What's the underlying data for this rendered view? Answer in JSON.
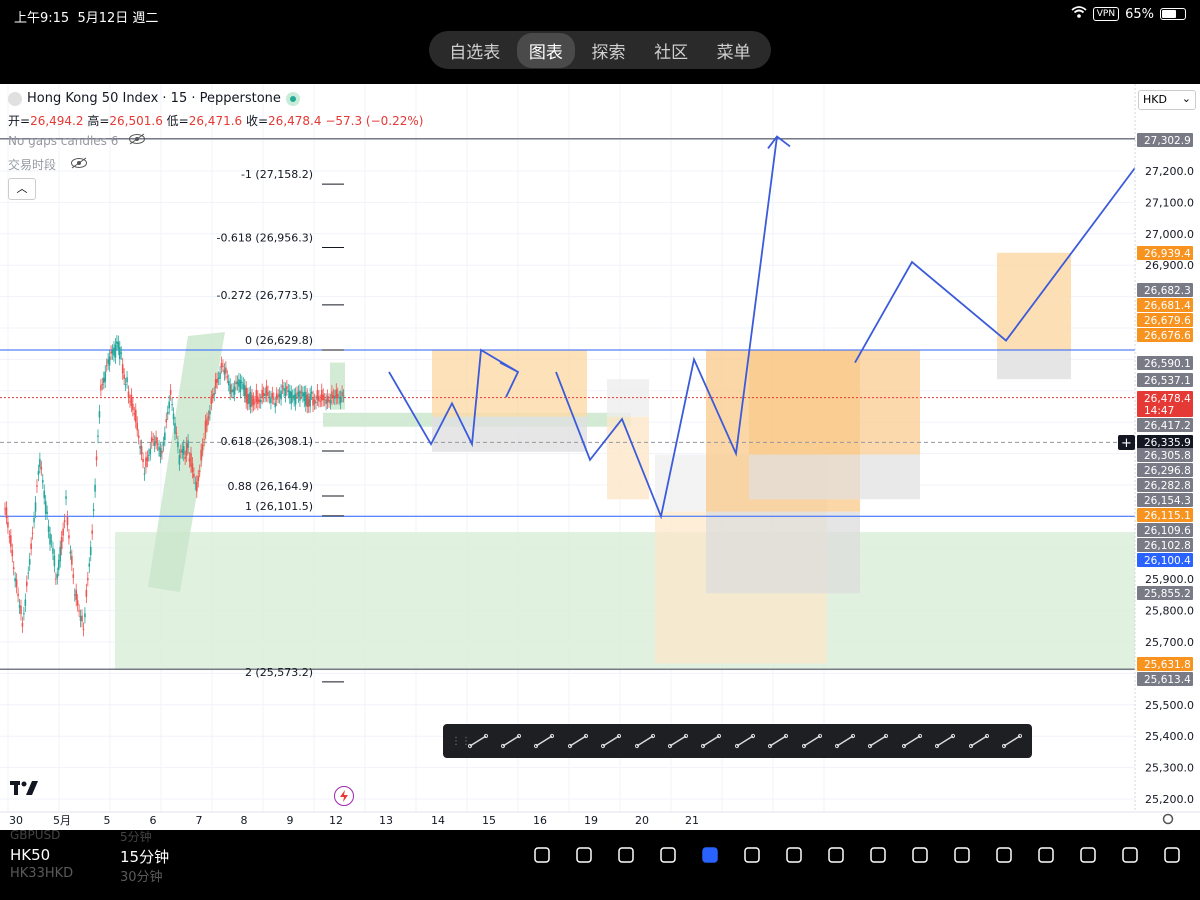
{
  "status": {
    "time": "上午9:15",
    "date": "5月12日 週二",
    "vpn": "VPN",
    "battery": "65%",
    "battery_level": 0.65
  },
  "nav": {
    "tabs": [
      "自选表",
      "图表",
      "探索",
      "社区",
      "菜单"
    ],
    "active": 1
  },
  "header": {
    "title": "Hong Kong 50 Index · 15 · Pepperstone",
    "ohlc": [
      {
        "label": "开=",
        "value": "26,494.2"
      },
      {
        "label": "高=",
        "value": "26,501.6"
      },
      {
        "label": "低=",
        "value": "26,471.6"
      },
      {
        "label": "收=",
        "value": "26,478.4"
      },
      {
        "label": "",
        "value": "−57.3 (−0.22%)"
      }
    ],
    "indicator": "No gaps candles 6",
    "session": "交易时段",
    "currency": "HKD"
  },
  "chart_data": {
    "type": "line",
    "title": "Hong Kong 50 Index · 15 · Pepperstone",
    "x_ticks": [
      "30",
      "5月",
      "5",
      "6",
      "7",
      "8",
      "9",
      "12",
      "13",
      "14",
      "15",
      "16",
      "19",
      "20",
      "21"
    ],
    "y_ticks": [
      "27,200.0",
      "27,100.0",
      "27,000.0",
      "26,900.0",
      "25,900.0",
      "25,800.0",
      "25,700.0",
      "25,500.0",
      "25,400.0",
      "25,300.0",
      "25,200.0"
    ],
    "ylim": [
      25150,
      27350
    ],
    "fib_levels": [
      {
        "ratio": "-1",
        "price": 27158.2,
        "label": "-1 (27,158.2)"
      },
      {
        "ratio": "-0.618",
        "price": 26956.3,
        "label": "-0.618 (26,956.3)"
      },
      {
        "ratio": "-0.272",
        "price": 26773.5,
        "label": "-0.272 (26,773.5)"
      },
      {
        "ratio": "0",
        "price": 26629.8,
        "label": "0 (26,629.8)"
      },
      {
        "ratio": "0.618",
        "price": 26308.1,
        "label": "0.618 (26,308.1)"
      },
      {
        "ratio": "0.88",
        "price": 26164.9,
        "label": "0.88 (26,164.9)"
      },
      {
        "ratio": "1",
        "price": 26101.5,
        "label": "1 (26,101.5)"
      },
      {
        "ratio": "2",
        "price": 25573.2,
        "label": "2 (25,573.2)"
      }
    ],
    "horizontal_lines": [
      27302.9,
      26629.8,
      26335.9,
      26100.4,
      25613.4
    ],
    "price_badges": [
      {
        "value": "27,302.9",
        "color": "#787b86"
      },
      {
        "value": "26,939.4",
        "color": "#f7931e"
      },
      {
        "value": "26,682.3",
        "color": "#787b86"
      },
      {
        "value": "26,681.4",
        "color": "#f7931e"
      },
      {
        "value": "26,679.6",
        "color": "#f7931e"
      },
      {
        "value": "26,676.6",
        "color": "#f7931e"
      },
      {
        "value": "26,590.1",
        "color": "#787b86"
      },
      {
        "value": "26,537.1",
        "color": "#787b86"
      },
      {
        "value": "26,478.4",
        "color": "#e53935"
      },
      {
        "value": "14:47",
        "color": "#e53935"
      },
      {
        "value": "26,417.2",
        "color": "#787b86"
      },
      {
        "value": "26,335.9",
        "color": "#131722"
      },
      {
        "value": "26,305.8",
        "color": "#787b86"
      },
      {
        "value": "26,296.8",
        "color": "#787b86"
      },
      {
        "value": "26,282.8",
        "color": "#787b86"
      },
      {
        "value": "26,154.3",
        "color": "#787b86"
      },
      {
        "value": "26,115.1",
        "color": "#f7931e"
      },
      {
        "value": "26,109.6",
        "color": "#787b86"
      },
      {
        "value": "26,102.8",
        "color": "#787b86"
      },
      {
        "value": "26,100.4",
        "color": "#2962ff"
      },
      {
        "value": "25,855.2",
        "color": "#787b86"
      },
      {
        "value": "25,631.8",
        "color": "#f7931e"
      },
      {
        "value": "25,613.4",
        "color": "#787b86"
      }
    ],
    "series": [
      {
        "name": "",
        "x": [
          0,
          1,
          2,
          3,
          4,
          5,
          6,
          7,
          8,
          9,
          10,
          11,
          12,
          13,
          14,
          15,
          16,
          17,
          18,
          19,
          20,
          21,
          22,
          23,
          24,
          25,
          26,
          27,
          28,
          29,
          30,
          31,
          32,
          33,
          34,
          35,
          36,
          37,
          38,
          39
        ],
        "values": [
          26150,
          25950,
          25760,
          26000,
          26280,
          26060,
          25900,
          26140,
          25870,
          25750,
          26050,
          26500,
          26600,
          26640,
          26520,
          26420,
          26250,
          26350,
          26300,
          26480,
          26280,
          26320,
          26200,
          26380,
          26500,
          26580,
          26490,
          26520,
          26470,
          26480,
          26500,
          26470,
          26510,
          26478,
          26480,
          26470,
          26490,
          26478,
          26485,
          26478
        ]
      }
    ],
    "forecast_path": [
      27310,
      26560,
      26330,
      26580,
      26410,
      26100,
      26620,
      26300,
      26860,
      26590,
      26810,
      26590,
      27310,
      26630,
      26900,
      26660,
      27210
    ]
  },
  "drawing_tools": [
    "horizontal-ray",
    "trend-line",
    "horizontal-line",
    "parallel-channel",
    "path",
    "pitchfork",
    "rectangle",
    "rotated-rectangle",
    "vertical-line",
    "ellipse",
    "long-position",
    "short-position",
    "callout",
    "date-price-range",
    "brush",
    "arrow",
    "text"
  ],
  "bottom": {
    "symbol_prev": "GBPUSD",
    "symbol": "HK50",
    "symbol_next": "HK33HKD",
    "tf_prev": "5分钟",
    "tf": "15分钟",
    "tf_next": "30分钟",
    "tools": [
      "pencil",
      "indicators",
      "grid",
      "compare",
      "pine",
      "add",
      "alert",
      "candles",
      "replay",
      "layers",
      "more",
      "undo",
      "fullscreen",
      "redo",
      "light",
      "share"
    ]
  }
}
